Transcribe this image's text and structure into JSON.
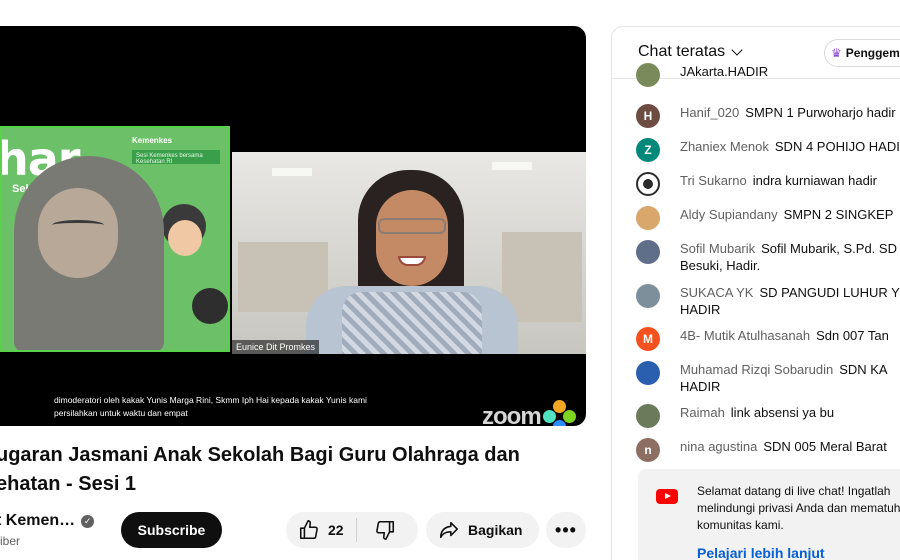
{
  "player": {
    "slide_title": "har",
    "slide_subtitle": "Sekolah",
    "slide_brand": "Kemenkes",
    "slide_box_text": "Sesi Kemenkes bersama Kesehatan RI",
    "speaker_name": "Eunice Dit Promkes",
    "caption": "dimoderatori oleh kakak Yunis Marga Rini, Skmm Iph Hai kepada kakak Yunis kami persilahkan untuk waktu dan empat",
    "zoom_logo": "zoom"
  },
  "video": {
    "title": "ugaran Jasmani Anak Sekolah Bagi Guru Olahraga dan ehatan - Sesi 1",
    "channel_name": "t Kemen…",
    "subscribers": "riber",
    "subscribe_label": "Subscribe",
    "like_count": "22",
    "share_label": "Bagikan",
    "more_label": "•••"
  },
  "chat": {
    "title": "Chat teratas",
    "supporters_label": "Penggem",
    "messages": [
      {
        "author": "",
        "text": "JAkarta.HADIR",
        "avatar_letter": "",
        "avatar_color": "#7a8a5a"
      },
      {
        "author": "Hanif_020",
        "text": "SMPN 1 Purwoharjo hadir",
        "avatar_letter": "H",
        "avatar_color": "#6d4c41"
      },
      {
        "author": "Zhaniex Menok",
        "text": "SDN 4 POHIJO HADIR",
        "avatar_letter": "Z",
        "avatar_color": "#00897b"
      },
      {
        "author": "Tri Sukarno",
        "text": "indra kurniawan hadir",
        "avatar_letter": "",
        "avatar_color": "#2b2b2b"
      },
      {
        "author": "Aldy Supiandany",
        "text": "SMPN 2 SINGKEP",
        "avatar_letter": "",
        "avatar_color": "#d9a66b"
      },
      {
        "author": "Sofil Mubarik",
        "text": "Sofil Mubarik, S.Pd. SD Besuki, Hadir.",
        "avatar_letter": "",
        "avatar_color": "#5f6f8a"
      },
      {
        "author": "SUKACA YK",
        "text": "SD PANGUDI LUHUR YK HADIR",
        "avatar_letter": "",
        "avatar_color": "#7d8f9a"
      },
      {
        "author": "4B- Mutik Atulhasanah",
        "text": "Sdn 007 Tan",
        "avatar_letter": "M",
        "avatar_color": "#f4511e"
      },
      {
        "author": "Muhamad Rizqi Sobarudin",
        "text": "SDN KA HADIR",
        "avatar_letter": "",
        "avatar_color": "#2a5fb0"
      },
      {
        "author": "Raimah",
        "text": "link absensi ya bu",
        "avatar_letter": "",
        "avatar_color": "#6a7a5a"
      },
      {
        "author": "nina agustina",
        "text": "SDN 005 Meral Barat",
        "avatar_letter": "n",
        "avatar_color": "#8d6e63"
      }
    ],
    "welcome_text": "Selamat datang di live chat! Ingatlah melindungi privasi Anda dan mematuhi komunitas kami.",
    "learn_more": "Pelajari lebih lanjut"
  }
}
